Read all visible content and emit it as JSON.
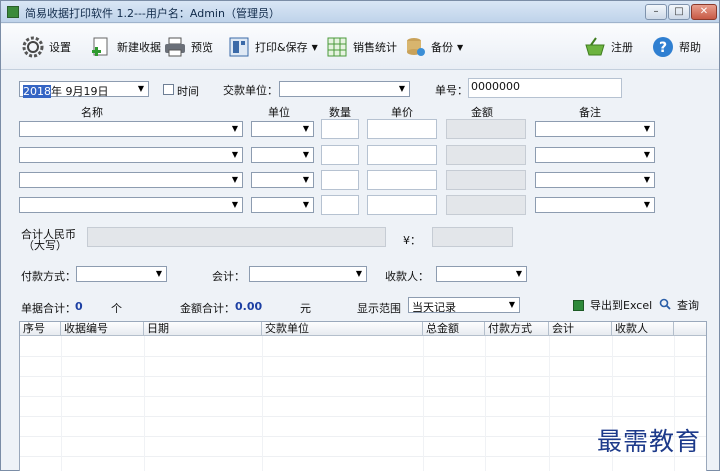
{
  "window": {
    "title": "简易收据打印软件 1.2---用户名：Admin（管理员）"
  },
  "toolbar": {
    "settings": "设置",
    "new_receipt": "新建收据",
    "preview": "预览",
    "print_save": "打印&保存",
    "sales_stats": "销售统计",
    "backup": "备份",
    "register": "注册",
    "help": "帮助"
  },
  "form": {
    "date_year_sel": "2018",
    "date_rest": "年  9月19日",
    "time_label": "时间",
    "payer_label": "交款单位：",
    "payer_value": "",
    "number_label": "单号：",
    "number_value": "0000000",
    "col_name": "名称",
    "col_unit": "单位",
    "col_qty": "数量",
    "col_price": "单价",
    "col_amount": "金额",
    "col_note": "备注",
    "total_rmb_label_1": "合计人民币",
    "total_rmb_label_2": "（大写）",
    "yuan_symbol": "¥：",
    "payment_method_label": "付款方式：",
    "accountant_label": "会计：",
    "payee_label": "收款人："
  },
  "summary": {
    "count_label": "单据合计：",
    "count_value": "0",
    "count_unit": "个",
    "amount_label": "金额合计：",
    "amount_value": "0.00",
    "amount_unit": "元",
    "range_label": "显示范围",
    "range_value": "当天记录",
    "export_label": "导出到Excel",
    "search_label": "查询"
  },
  "grid": {
    "headers": [
      "序号",
      "收据编号",
      "日期",
      "交款单位",
      "总金额",
      "付款方式",
      "会计",
      "收款人"
    ]
  },
  "watermark": "最需教育"
}
